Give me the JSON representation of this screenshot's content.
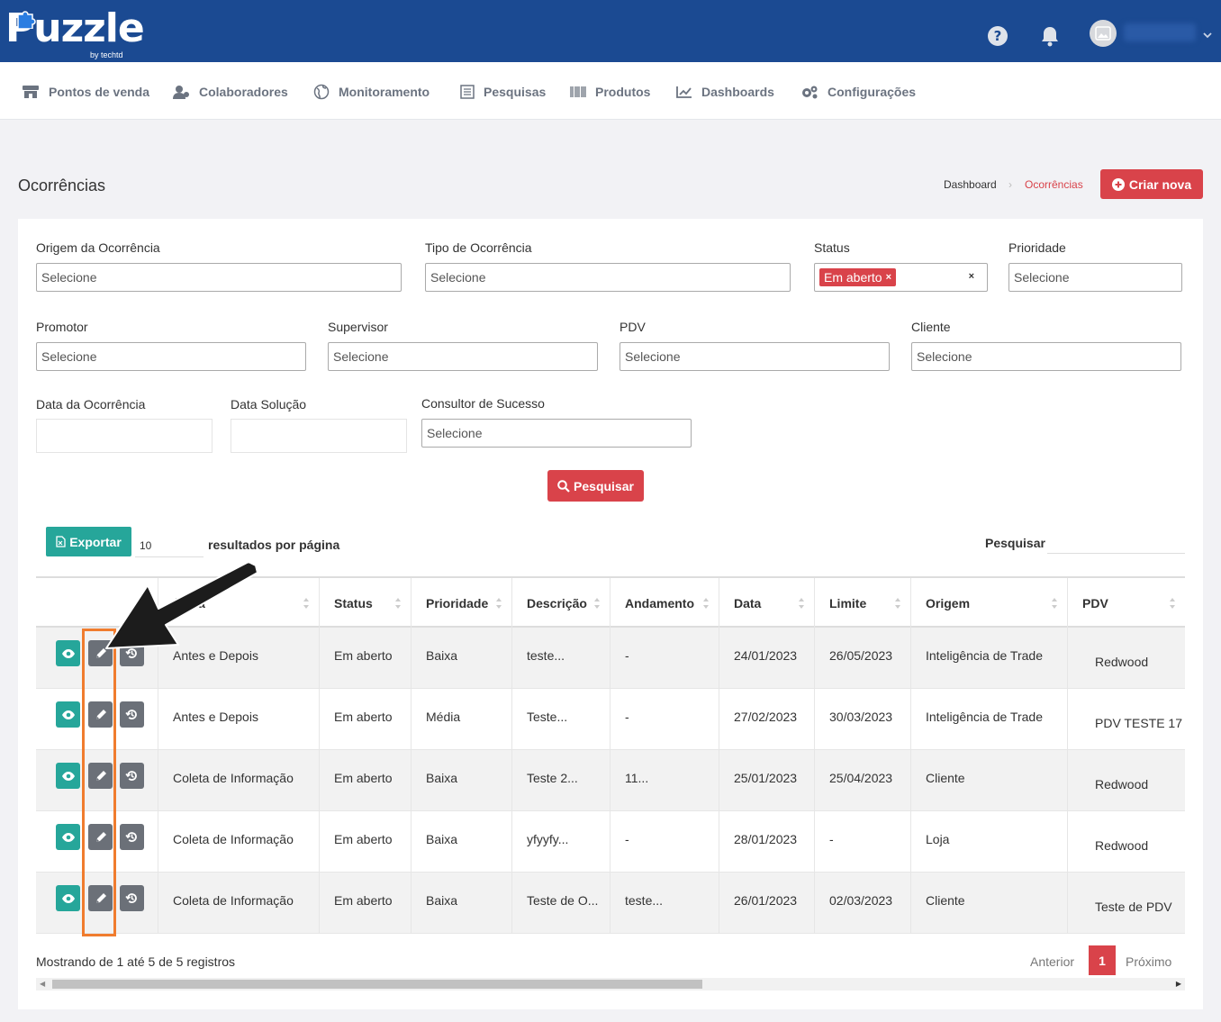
{
  "brand": {
    "name": "Puzzle",
    "tagline": "by techtd"
  },
  "header": {
    "help_icon": "question-circle-icon",
    "notifications_icon": "bell-icon",
    "avatar_icon": "image-placeholder-icon"
  },
  "nav": {
    "items": [
      {
        "label": "Pontos de venda",
        "icon": "store-icon"
      },
      {
        "label": "Colaboradores",
        "icon": "users-icon"
      },
      {
        "label": "Monitoramento",
        "icon": "globe-icon"
      },
      {
        "label": "Pesquisas",
        "icon": "form-icon"
      },
      {
        "label": "Produtos",
        "icon": "barcode-icon"
      },
      {
        "label": "Dashboards",
        "icon": "line-chart-icon"
      },
      {
        "label": "Configurações",
        "icon": "gears-icon"
      }
    ]
  },
  "page": {
    "title": "Ocorrências",
    "breadcrumb": [
      "Dashboard",
      "Ocorrências"
    ],
    "create_button": "Criar nova"
  },
  "filters": {
    "origem": {
      "label": "Origem da Ocorrência",
      "placeholder": "Selecione"
    },
    "tipo": {
      "label": "Tipo de Ocorrência",
      "placeholder": "Selecione"
    },
    "status": {
      "label": "Status",
      "selected_tag": "Em aberto",
      "tag_remove": "×",
      "clear": "×"
    },
    "prioridade": {
      "label": "Prioridade",
      "placeholder": "Selecione"
    },
    "promotor": {
      "label": "Promotor",
      "placeholder": "Selecione"
    },
    "supervisor": {
      "label": "Supervisor",
      "placeholder": "Selecione"
    },
    "pdv": {
      "label": "PDV",
      "placeholder": "Selecione"
    },
    "cliente": {
      "label": "Cliente",
      "placeholder": "Selecione"
    },
    "data_ocorrencia": {
      "label": "Data da Ocorrência",
      "value": ""
    },
    "data_solucao": {
      "label": "Data Solução",
      "value": ""
    },
    "consultor": {
      "label": "Consultor de Sucesso",
      "placeholder": "Selecione"
    },
    "search_button": "Pesquisar"
  },
  "toolbar": {
    "export_button": "Exportar",
    "per_page_value": "10",
    "per_page_label": "resultados por página",
    "search_label": "Pesquisar"
  },
  "table": {
    "columns": [
      "",
      "ência",
      "Status",
      "Prioridade",
      "Descrição",
      "Andamento",
      "Data",
      "Limite",
      "Origem",
      "PDV"
    ],
    "rows": [
      {
        "tipo": "Antes e Depois",
        "status": "Em aberto",
        "prioridade": "Baixa",
        "descricao": "teste...",
        "andamento": "-",
        "data": "24/01/2023",
        "limite": "26/05/2023",
        "origem": "Inteligência de Trade",
        "pdv": "Redwood"
      },
      {
        "tipo": "Antes e Depois",
        "status": "Em aberto",
        "prioridade": "Média",
        "descricao": "Teste...",
        "andamento": "-",
        "data": "27/02/2023",
        "limite": "30/03/2023",
        "origem": "Inteligência de Trade",
        "pdv": "PDV TESTE 17"
      },
      {
        "tipo": "Coleta de Informação",
        "status": "Em aberto",
        "prioridade": "Baixa",
        "descricao": "Teste 2...",
        "andamento": "11...",
        "data": "25/01/2023",
        "limite": "25/04/2023",
        "origem": "Cliente",
        "pdv": "Redwood"
      },
      {
        "tipo": "Coleta de Informação",
        "status": "Em aberto",
        "prioridade": "Baixa",
        "descricao": "yfyyfy...",
        "andamento": "-",
        "data": "28/01/2023",
        "limite": "-",
        "origem": "Loja",
        "pdv": "Redwood"
      },
      {
        "tipo": "Coleta de Informação",
        "status": "Em aberto",
        "prioridade": "Baixa",
        "descricao": "Teste de O...",
        "andamento": "teste...",
        "data": "26/01/2023",
        "limite": "02/03/2023",
        "origem": "Cliente",
        "pdv": "Teste de PDV"
      }
    ],
    "row_actions": [
      "eye-icon",
      "pencil-icon",
      "history-icon"
    ]
  },
  "footer": {
    "info": "Mostrando de 1 até 5 de 5 registros",
    "prev": "Anterior",
    "current_page": "1",
    "next": "Próximo"
  },
  "colors": {
    "brand_blue": "#1b4a92",
    "accent_red": "#d9434a",
    "teal": "#26a69a",
    "annotation_orange": "#f07c2e"
  }
}
